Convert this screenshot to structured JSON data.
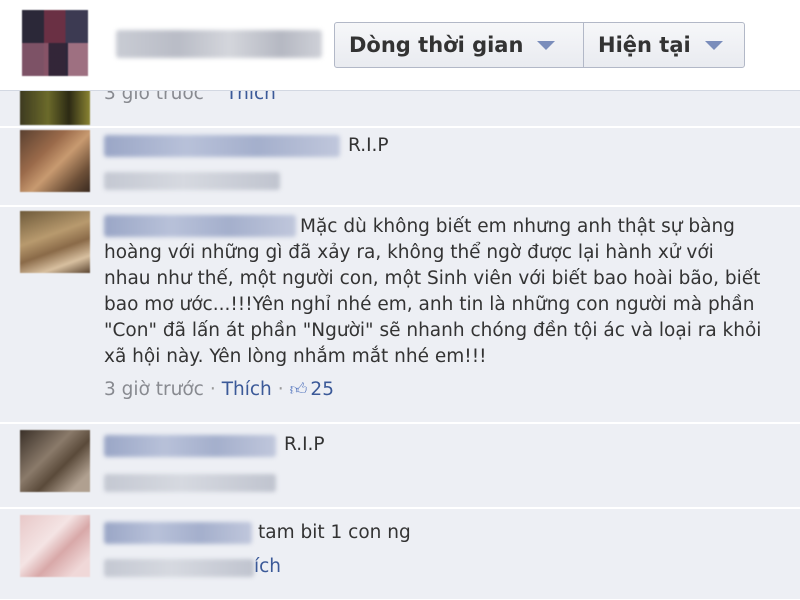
{
  "header": {
    "timeline_label": "Dòng thời gian",
    "current_label": "Hiện tại"
  },
  "comments": [
    {
      "text": "",
      "time": "3 giờ trước",
      "like_label": "Thích"
    },
    {
      "text": "R.I.P"
    },
    {
      "text_lines": [
        "Mặc dù không biết em nhưng anh thật sự bàng",
        "hoàng với những gì đã xảy ra, không thể ngờ được lại hành xử với",
        "nhau như thế, một người con, một Sinh viên với biết bao hoài bão, biết",
        "bao mơ ước...!!!Yên nghỉ nhé em, anh tin là những con người mà phần",
        "\"Con\" đã lấn át phần \"Người\" sẽ nhanh chóng đền tội ác và loại ra khỏi",
        "xã hội này. Yên lòng nhắm mắt nhé em!!!"
      ],
      "time": "3 giờ trước",
      "separator": "·",
      "like_label": "Thích",
      "like_count": "25"
    },
    {
      "text": "R.I.P"
    },
    {
      "text": "tam bit 1 con ng",
      "like_label": "ích"
    }
  ],
  "colors": {
    "comment_bg": "#edeff4",
    "link": "#3b5998",
    "text": "#333333",
    "muted": "#888a90"
  }
}
